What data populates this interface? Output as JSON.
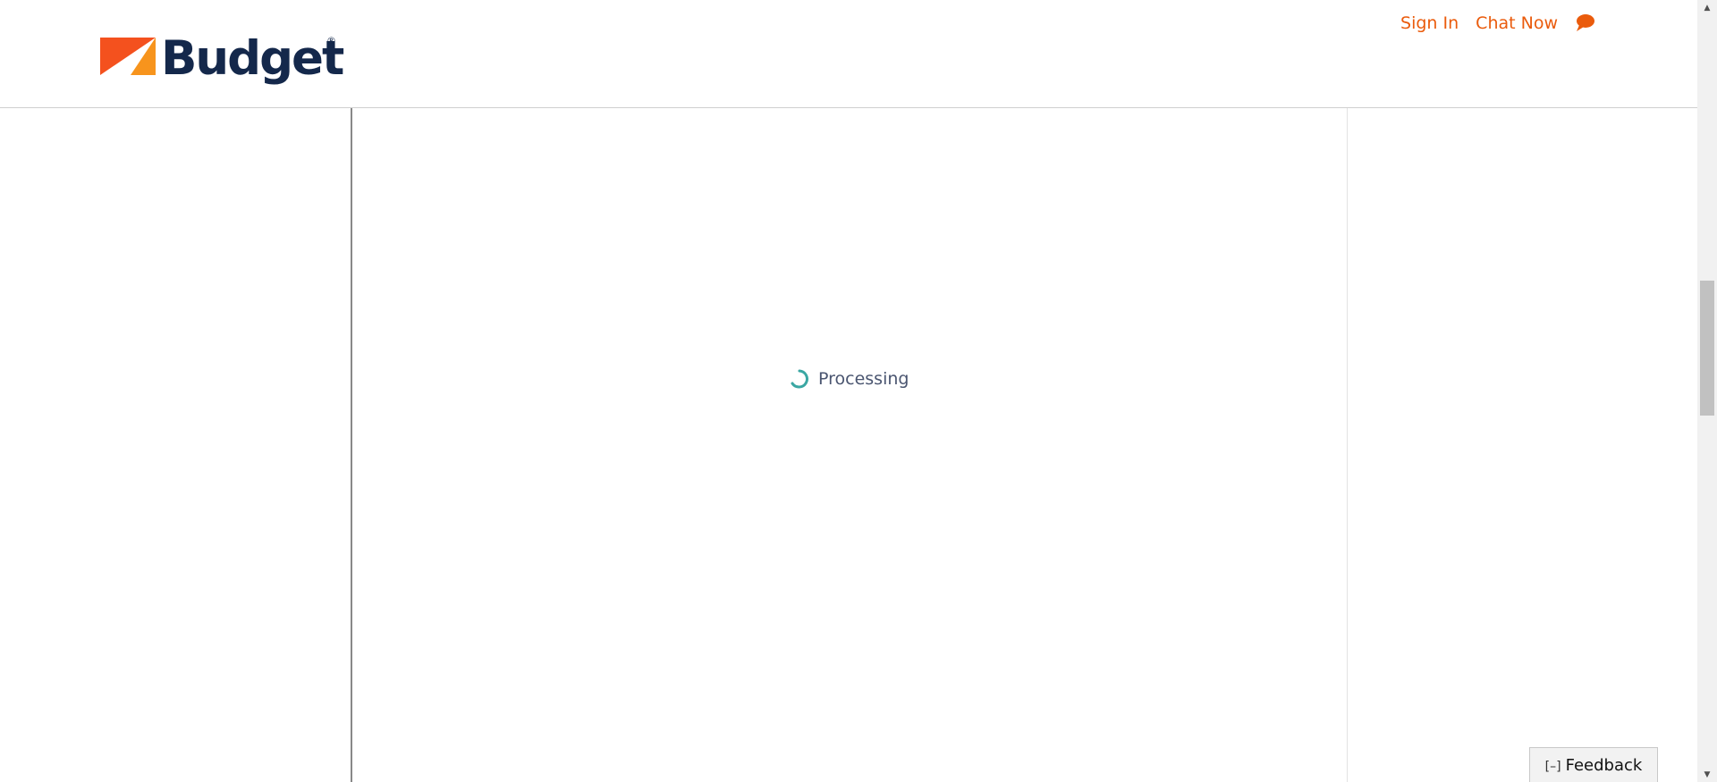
{
  "header": {
    "logo": {
      "text": "Budget",
      "registered_mark": "®",
      "colors": {
        "navy": "#14284b",
        "orange_red": "#f4511e",
        "orange": "#f7941d"
      }
    },
    "links": {
      "sign_in": "Sign In",
      "chat_now": "Chat Now"
    },
    "chat_icon": "speech-bubble-icon",
    "link_color": "#ea5b0c"
  },
  "main": {
    "status_text": "Processing",
    "spinner_icon": "loading-spinner-icon",
    "spinner_color": "#3aa7a3"
  },
  "feedback": {
    "icon_text": "[–]",
    "label": "Feedback"
  },
  "scrollbar": {
    "up_icon": "scroll-up-arrow-icon",
    "down_icon": "scroll-down-arrow-icon"
  }
}
